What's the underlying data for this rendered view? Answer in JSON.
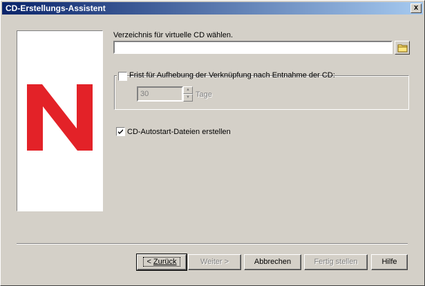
{
  "window": {
    "title": "CD-Erstellungs-Assistent",
    "close_glyph": "x"
  },
  "directory": {
    "label": "Verzeichnis für virtuelle CD wählen.",
    "value": ""
  },
  "unlink": {
    "label": "Frist für Aufhebung der Verknüpfung nach Entnahme der CD:",
    "checked": false,
    "days_value": "30",
    "days_unit": "Tage"
  },
  "autostart": {
    "label": "CD-Autostart-Dateien erstellen",
    "checked": true
  },
  "buttons": {
    "back_prefix": "< ",
    "back_label": "Zurück",
    "next_label": "Weiter >",
    "cancel_label": "Abbrechen",
    "finish_label": "Fertig stellen",
    "help_label": "Hilfe"
  },
  "colors": {
    "logo_red": "#e32228",
    "title_start": "#0a246a",
    "title_end": "#a6caf0"
  },
  "icons": {
    "folder": "folder-icon",
    "check": "check-icon",
    "logo": "novell-n-logo"
  }
}
